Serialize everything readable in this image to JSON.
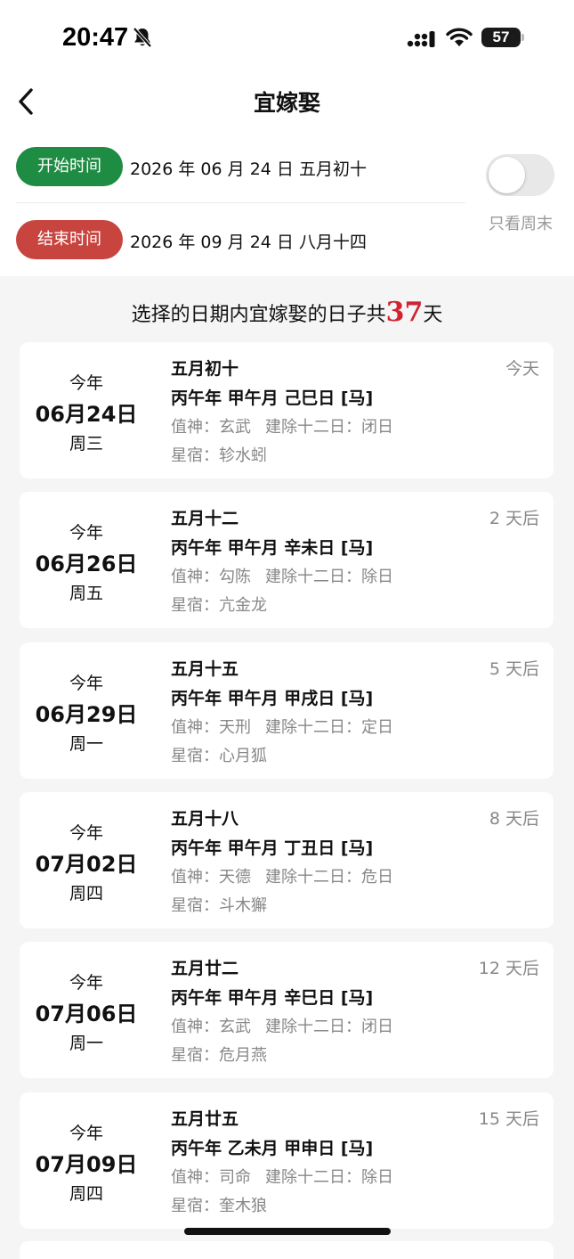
{
  "status_bar": {
    "time": "20:47",
    "battery": "57"
  },
  "nav": {
    "title": "宜嫁娶"
  },
  "range": {
    "start_label": "开始时间",
    "start_value": "2026 年 06 月 24 日  五月初十",
    "end_label": "结束时间",
    "end_value": "2026 年 09 月 24 日  八月十四"
  },
  "weekend_toggle": {
    "label": "只看周末",
    "on": false
  },
  "summary": {
    "prefix": "选择的日期内宜嫁娶的日子共",
    "count": "37",
    "suffix": "天"
  },
  "days": [
    {
      "year": "今年",
      "date": "06月24日",
      "week": "周三",
      "lunar": "五月初十",
      "ganzhi": "丙午年 甲午月 己巳日 [马]",
      "shen_label": "值神：",
      "shen": "玄武",
      "jianchu_label": "建除十二日：",
      "jianchu": "闭日",
      "xiu_label": "星宿：",
      "xiu": "轸水蚓",
      "relative": "今天"
    },
    {
      "year": "今年",
      "date": "06月26日",
      "week": "周五",
      "lunar": "五月十二",
      "ganzhi": "丙午年 甲午月 辛未日 [马]",
      "shen_label": "值神：",
      "shen": "勾陈",
      "jianchu_label": "建除十二日：",
      "jianchu": "除日",
      "xiu_label": "星宿：",
      "xiu": "亢金龙",
      "relative": "2 天后"
    },
    {
      "year": "今年",
      "date": "06月29日",
      "week": "周一",
      "lunar": "五月十五",
      "ganzhi": "丙午年 甲午月 甲戌日 [马]",
      "shen_label": "值神：",
      "shen": "天刑",
      "jianchu_label": "建除十二日：",
      "jianchu": "定日",
      "xiu_label": "星宿：",
      "xiu": "心月狐",
      "relative": "5 天后"
    },
    {
      "year": "今年",
      "date": "07月02日",
      "week": "周四",
      "lunar": "五月十八",
      "ganzhi": "丙午年 甲午月 丁丑日 [马]",
      "shen_label": "值神：",
      "shen": "天德",
      "jianchu_label": "建除十二日：",
      "jianchu": "危日",
      "xiu_label": "星宿：",
      "xiu": "斗木獬",
      "relative": "8 天后"
    },
    {
      "year": "今年",
      "date": "07月06日",
      "week": "周一",
      "lunar": "五月廿二",
      "ganzhi": "丙午年 甲午月 辛巳日 [马]",
      "shen_label": "值神：",
      "shen": "玄武",
      "jianchu_label": "建除十二日：",
      "jianchu": "闭日",
      "xiu_label": "星宿：",
      "xiu": "危月燕",
      "relative": "12 天后"
    },
    {
      "year": "今年",
      "date": "07月09日",
      "week": "周四",
      "lunar": "五月廿五",
      "ganzhi": "丙午年 乙未月 甲申日 [马]",
      "shen_label": "值神：",
      "shen": "司命",
      "jianchu_label": "建除十二日：",
      "jianchu": "除日",
      "xiu_label": "星宿：",
      "xiu": "奎木狼",
      "relative": "15 天后"
    }
  ],
  "colors": {
    "start_pill": "#1f8c44",
    "end_pill": "#c8453f",
    "count": "#d02530"
  },
  "icons": {
    "bell": "bell-slash-icon",
    "back": "chevron-left-icon",
    "signal": "cellular-signal-icon",
    "wifi": "wifi-icon",
    "battery": "battery-icon"
  }
}
